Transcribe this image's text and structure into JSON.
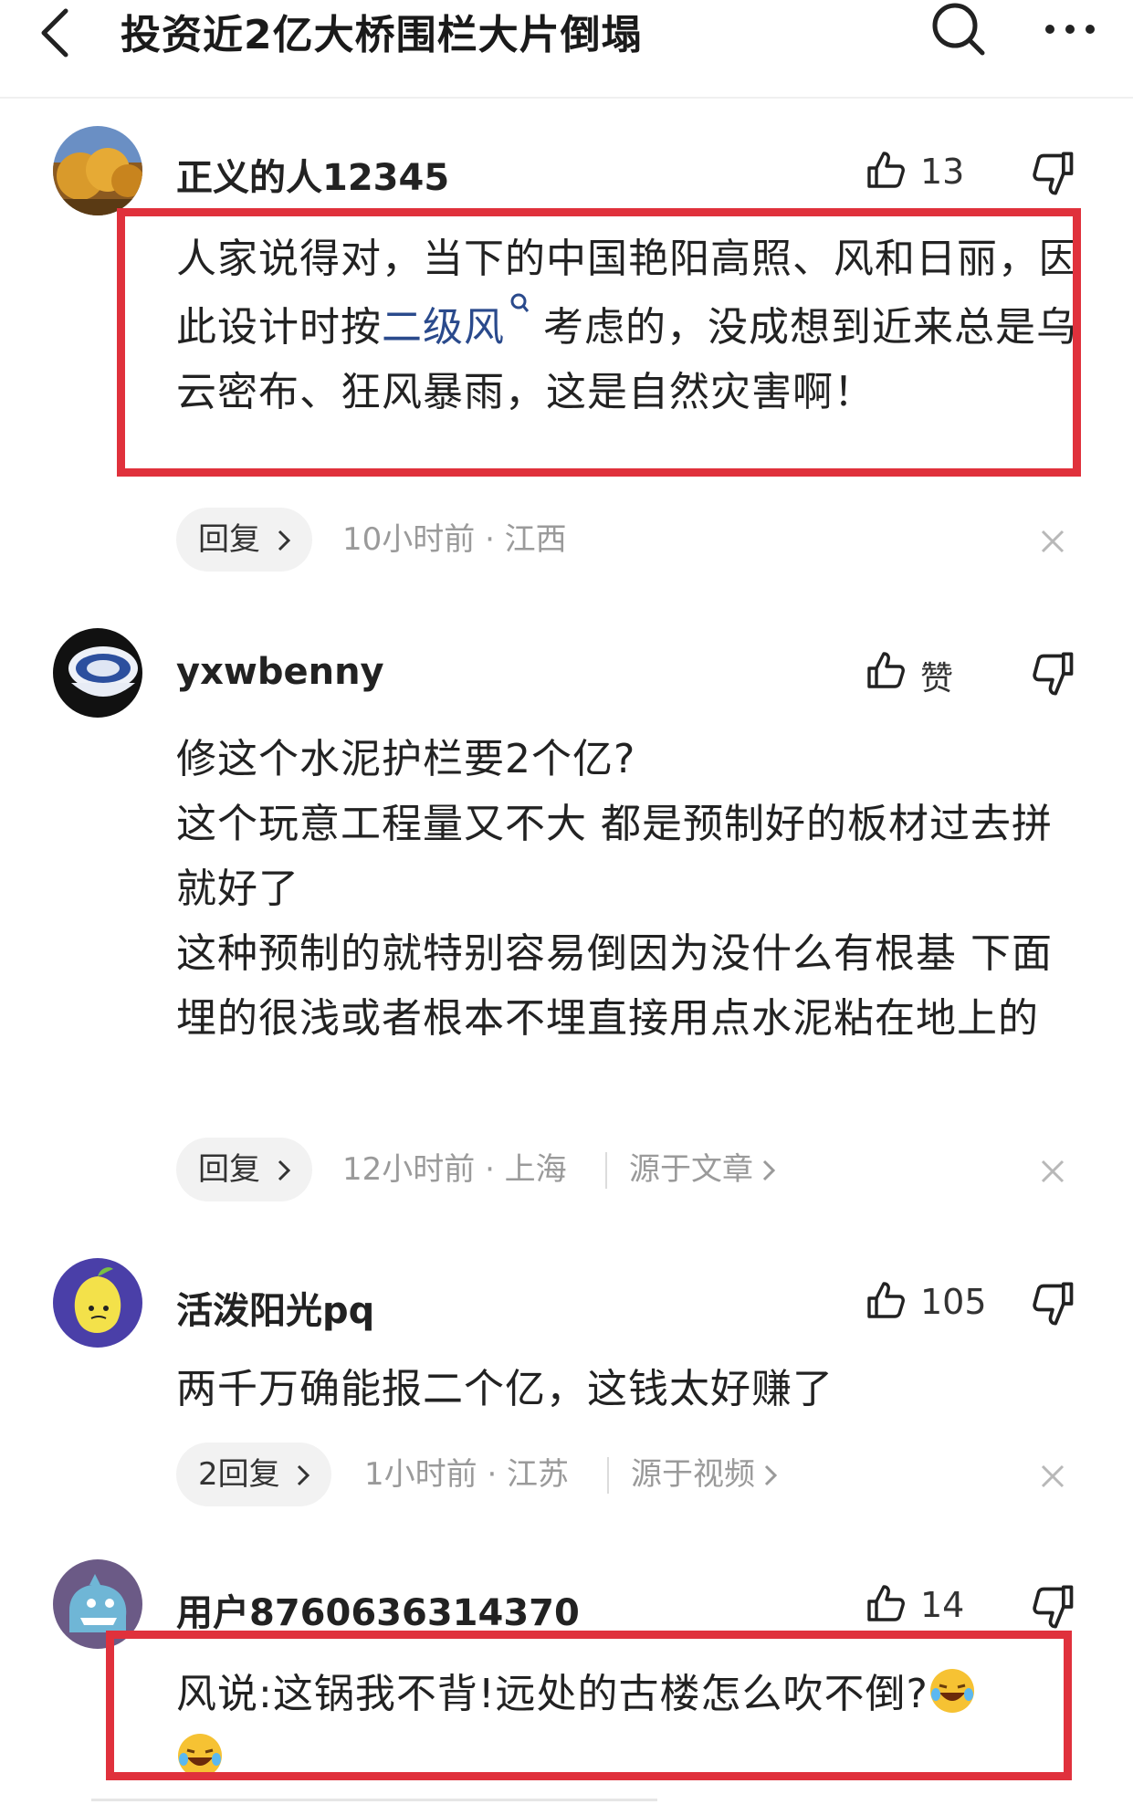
{
  "header": {
    "title": "投资近2亿大桥围栏大片倒塌",
    "icons": [
      "back-icon",
      "search-icon",
      "more-icon"
    ]
  },
  "comments": [
    {
      "username": "正义的人12345",
      "likes": "13",
      "text_before": "人家说得对，当下的中国艳阳高照、风和日丽，因此设计时按",
      "keyword": "二级风",
      "text_after": "考虑的，没成想到近来总是乌云密布、狂风暴雨，这是自然灾害啊！",
      "reply": "回复",
      "time_location": "10小时前 · 江西"
    },
    {
      "username": "yxwbenny",
      "likes": "赞",
      "lines": [
        "修这个水泥护栏要2个亿?",
        "这个玩意工程量又不大 都是预制好的板材过去拼就好了",
        "这种预制的就特别容易倒因为没什么有根基 下面埋的很浅或者根本不埋直接用点水泥粘在地上的"
      ],
      "reply": "回复",
      "time_location": "12小时前 · 上海",
      "source": "源于文章"
    },
    {
      "username": "活泼阳光pq",
      "likes": "105",
      "text": "两千万确能报二个亿，这钱太好赚了",
      "reply": "2回复",
      "time_location": "1小时前 · 江苏",
      "source": "源于视频"
    },
    {
      "username": "用户8760636314370",
      "likes": "14",
      "text": "风说:这锅我不背!远处的古楼怎么吹不倒?"
    }
  ],
  "colors": {
    "highlight_box": "#e0313c",
    "keyword_link": "#2a4a8c",
    "meta_text": "#9a9a9a",
    "pill_bg": "#f2f2f2"
  }
}
